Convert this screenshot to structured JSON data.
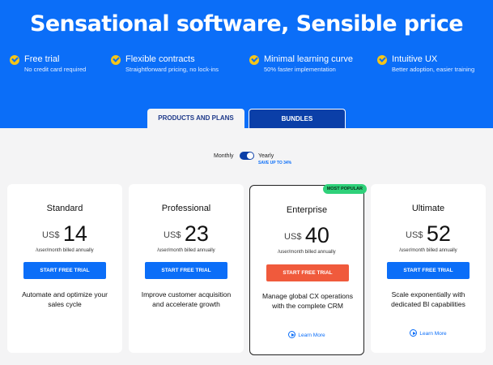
{
  "hero": {
    "headline": "Sensational software, Sensible price",
    "features": [
      {
        "title": "Free trial",
        "subtitle": "No credit card required"
      },
      {
        "title": "Flexible contracts",
        "subtitle": "Straightforward pricing, no lock-ins"
      },
      {
        "title": "Minimal learning curve",
        "subtitle": "50% faster implementation"
      },
      {
        "title": "Intuitive UX",
        "subtitle": "Better adoption, easier training"
      }
    ]
  },
  "tabs": {
    "products": "PRODUCTS AND PLANS",
    "bundles": "BUNDLES"
  },
  "billing": {
    "monthly": "Monthly",
    "yearly": "Yearly",
    "save": "SAVE UP TO 34%",
    "selected": "Yearly"
  },
  "plans": [
    {
      "name": "Standard",
      "currency": "US$",
      "price": "14",
      "billed": "/user/month billed annually",
      "cta": "START FREE TRIAL",
      "description": "Automate and optimize your sales cycle"
    },
    {
      "name": "Professional",
      "currency": "US$",
      "price": "23",
      "billed": "/user/month billed annually",
      "cta": "START FREE TRIAL",
      "description": "Improve customer acquisition and accelerate growth"
    },
    {
      "name": "Enterprise",
      "currency": "US$",
      "price": "40",
      "billed": "/user/month billed annually",
      "cta": "START FREE TRIAL",
      "description": "Manage global CX operations with the complete CRM",
      "learn_more": "Learn More",
      "badge": "MOST POPULAR"
    },
    {
      "name": "Ultimate",
      "currency": "US$",
      "price": "52",
      "billed": "/user/month billed annually",
      "cta": "START FREE TRIAL",
      "description": "Scale exponentially with dedicated BI capabilities",
      "learn_more": "Learn More"
    }
  ],
  "colors": {
    "brand_blue": "#0b6ef8",
    "navy": "#0b3fa8",
    "featured_cta": "#f05a3c",
    "check_yellow": "#f5c518",
    "badge_green": "#2fd17a"
  }
}
